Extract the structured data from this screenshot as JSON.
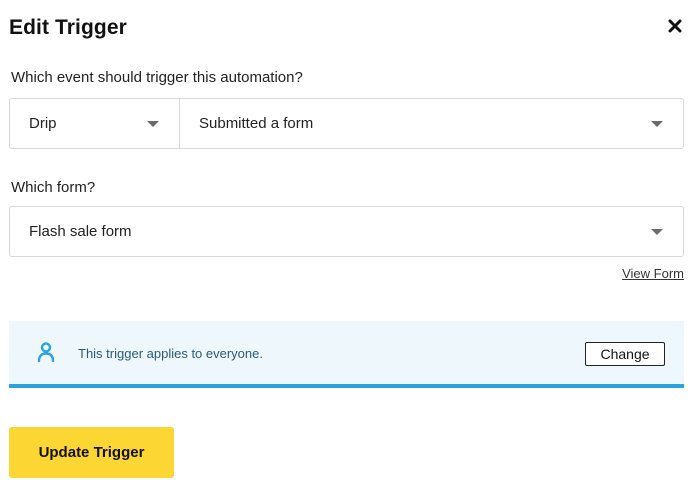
{
  "dialog": {
    "title": "Edit Trigger",
    "close_icon": "close-icon"
  },
  "event": {
    "question": "Which event should trigger this automation?",
    "source_value": "Drip",
    "event_value": "Submitted a form"
  },
  "form": {
    "question": "Which form?",
    "selected_form": "Flash sale form",
    "view_link": "View Form"
  },
  "audience": {
    "icon": "person-icon",
    "text": "This trigger applies to everyone.",
    "change_label": "Change"
  },
  "actions": {
    "update_label": "Update Trigger"
  },
  "colors": {
    "primary_button": "#fcd734",
    "banner_background": "#eef7fb",
    "banner_accent": "#2aa3e0"
  }
}
